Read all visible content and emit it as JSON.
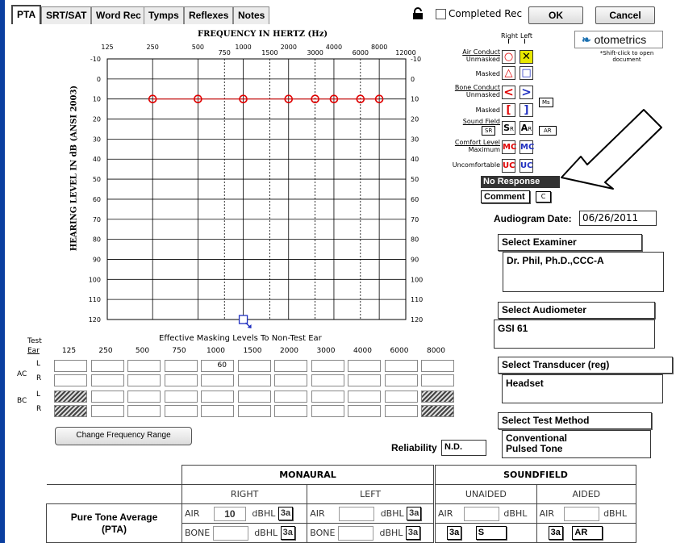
{
  "tabs": [
    "PTA",
    "SRT/SAT",
    "Word Rec",
    "Tymps",
    "Reflexes",
    "Notes"
  ],
  "completed_label": "Completed Rec",
  "ok_label": "OK",
  "cancel_label": "Cancel",
  "audiogram": {
    "freq_title": "FREQUENCY IN HERTZ (Hz)",
    "ylabel": "HEARING LEVEL IN dB (ANSI 2003)",
    "top_freqs_major": [
      "125",
      "250",
      "500",
      "1000",
      "2000",
      "4000",
      "8000"
    ],
    "top_freqs_minor": [
      "750",
      "1500",
      "3000",
      "6000",
      "12000"
    ],
    "y_labels": [
      "-10",
      "0",
      "10",
      "20",
      "30",
      "40",
      "50",
      "60",
      "70",
      "80",
      "90",
      "100",
      "110",
      "120"
    ],
    "no_response_marker": "down-arrow-icon"
  },
  "chart_data": {
    "type": "scatter",
    "title": "FREQUENCY IN HERTZ (Hz)",
    "xlabel": "",
    "ylabel": "HEARING LEVEL IN dB (ANSI 2003)",
    "ylim": [
      -10,
      120
    ],
    "series": [
      {
        "name": "Air Conduct Unmasked",
        "ear": "Right",
        "symbol": "O",
        "color": "#e00000",
        "x": [
          250,
          500,
          1000,
          2000,
          3000,
          4000,
          6000,
          8000
        ],
        "y": [
          10,
          10,
          10,
          10,
          10,
          10,
          10,
          10
        ]
      }
    ]
  },
  "legend": {
    "right": "Right",
    "left": "Left",
    "air_conduct": "Air Conduct",
    "unmasked": "Unmasked",
    "masked": "Masked",
    "bone_conduct": "Bone Conduct",
    "bone_unmasked": "Unmasked",
    "bone_masked": "Masked",
    "sound_field": "Sound Field",
    "comfort_level": "Comfort Level",
    "maximum": "Maximum",
    "uncomfortable": "Uncomfortable",
    "ms": "Ms",
    "sr": "SR",
    "ar": "AR",
    "s_sym": "S",
    "r_sub": "R",
    "a_sym": "A",
    "r_sub2": "R",
    "mc": "MC",
    "uc": "UC",
    "no_response": "No Response",
    "comment": "Comment",
    "c": "C"
  },
  "brand": {
    "name": "otometrics",
    "hint": "*Shift-click to open document"
  },
  "audiogram_date_label": "Audiogram Date:",
  "audiogram_date": "06/26/2011",
  "examiner": {
    "header": "Select Examiner",
    "value": "Dr. Phil, Ph.D.,CCC-A"
  },
  "audiometer": {
    "header": "Select Audiometer",
    "value": "GSI 61"
  },
  "transducer": {
    "header": "Select Transducer (reg)",
    "value": "Headset"
  },
  "method": {
    "header": "Select Test Method",
    "line1": "Conventional",
    "line2": "Pulsed Tone"
  },
  "masking": {
    "title": "Effective Masking Levels To Non-Test Ear",
    "test": "Test",
    "ear": "Ear",
    "freqs": [
      "125",
      "250",
      "500",
      "750",
      "1000",
      "1500",
      "2000",
      "3000",
      "4000",
      "6000",
      "8000"
    ],
    "ac": "AC",
    "bc": "BC",
    "l": "L",
    "r": "R",
    "ac_l_1000": "60"
  },
  "change_freq": "Change Frequency Range",
  "reliability_label": "Reliability",
  "reliability_value": "N.D.",
  "pta": {
    "monaural": "MONAURAL",
    "soundfield": "SOUNDFIELD",
    "right": "RIGHT",
    "left": "LEFT",
    "unaided": "UNAIDED",
    "aided": "AIDED",
    "label1": "Pure Tone Average",
    "label2": "(PTA)",
    "air": "AIR",
    "bone": "BONE",
    "dbhl": "dBHL",
    "b3a": "3a",
    "right_air": "10",
    "s": "S",
    "ar": "AR"
  }
}
